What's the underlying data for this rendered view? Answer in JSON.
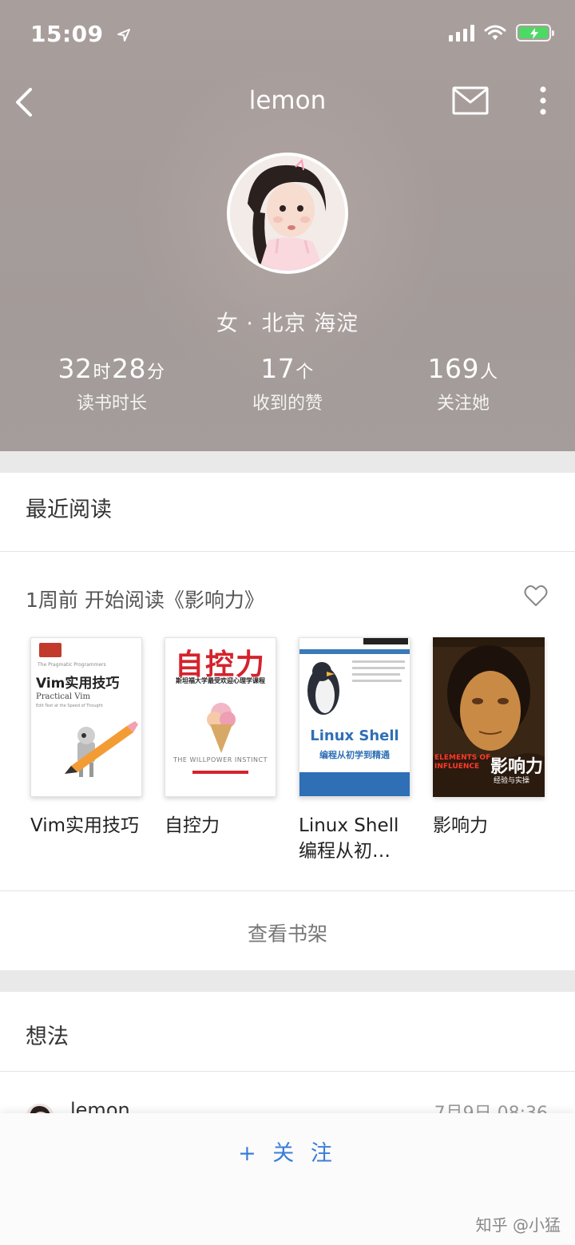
{
  "status_bar": {
    "time": "15:09",
    "battery_color": "#4cd964"
  },
  "nav": {
    "title": "lemon",
    "back_icon": "chevron-left-icon",
    "mail_icon": "envelope-icon",
    "more_icon": "more-vertical-icon"
  },
  "profile": {
    "location": "女 · 北京 海淀",
    "stats": [
      {
        "value_parts": [
          "32",
          "时",
          "28",
          "分"
        ],
        "label": "读书时长"
      },
      {
        "value_parts": [
          "17",
          "个"
        ],
        "label": "收到的赞"
      },
      {
        "value_parts": [
          "169",
          "人"
        ],
        "label": "关注她"
      }
    ]
  },
  "recent": {
    "title": "最近阅读",
    "reading_line": "1周前 开始阅读《影响力》",
    "books": [
      {
        "title": "Vim实用技巧",
        "cover": {
          "top_text": "Vim实用技巧",
          "sub_text": "Practical Vim",
          "small_text": "Edit Text at the Speed of Thought",
          "series": "The Pragmatic Programmers"
        }
      },
      {
        "title": "自控力",
        "cover": {
          "top_text": "自控力",
          "sub_text": "斯坦福大学最受欢迎心理学课程",
          "small_text": "THE WILLPOWER INSTINCT"
        }
      },
      {
        "title": "Linux Shell 编程从初…",
        "cover": {
          "top_text": "Linux Shell",
          "sub_text": "编程从初学到精通"
        }
      },
      {
        "title": "影响力",
        "cover": {
          "top_text": "影响力",
          "sub_text": "ELEMENTS OF INFLUENCE",
          "small_text": "经验与实操"
        }
      }
    ],
    "view_shelf": "查看书架"
  },
  "ideas": {
    "title": "想法",
    "user": "lemon",
    "time": "7月9日 08:36"
  },
  "footer": {
    "follow_label": "+ 关 注",
    "follow_color": "#3b7dd8",
    "watermark": "知乎 @小猛"
  }
}
